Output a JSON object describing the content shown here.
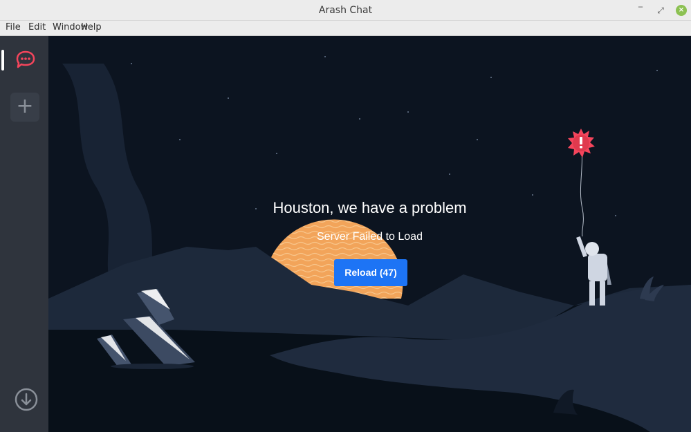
{
  "window": {
    "title": "Arash Chat"
  },
  "menubar": {
    "items": [
      "File",
      "Edit",
      "Window",
      "Help"
    ]
  },
  "sidebar": {
    "server_icon": "rocket-chat-icon",
    "add_icon": "plus-icon",
    "add_label": "+",
    "download_icon": "download-icon"
  },
  "error": {
    "title": "Houston, we have a problem",
    "subtitle": "Server Failed to Load",
    "reload_label": "Reload (47)"
  },
  "colors": {
    "accent": "#1d74f5",
    "sidebar": "#2f343d",
    "background": "#0c1420",
    "brand_red": "#f5455c",
    "sun": "#f2a45a"
  }
}
